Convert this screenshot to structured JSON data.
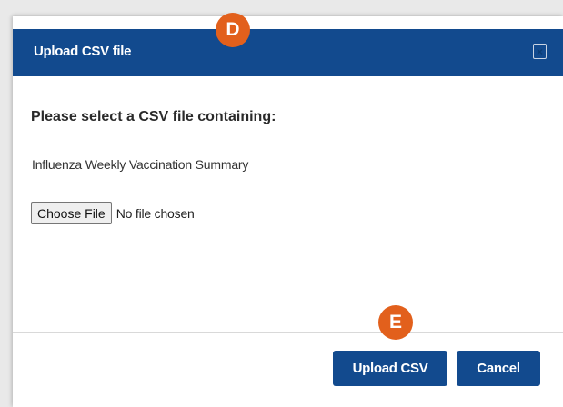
{
  "dialog": {
    "title": "Upload CSV file",
    "close_icon": "close-icon",
    "close_glyph": "×",
    "heading": "Please select a CSV file containing:",
    "subtitle": "Influenza Weekly Vaccination Summary",
    "file_input": {
      "button_label": "Choose File",
      "status": "No file chosen"
    },
    "buttons": {
      "upload_label": "Upload CSV",
      "cancel_label": "Cancel"
    }
  },
  "markers": {
    "d": "D",
    "e": "E"
  },
  "colors": {
    "header_bg": "#124a8e",
    "primary_button": "#124a8e",
    "marker": "#e2601c",
    "page_bg": "#e9e9e9"
  }
}
